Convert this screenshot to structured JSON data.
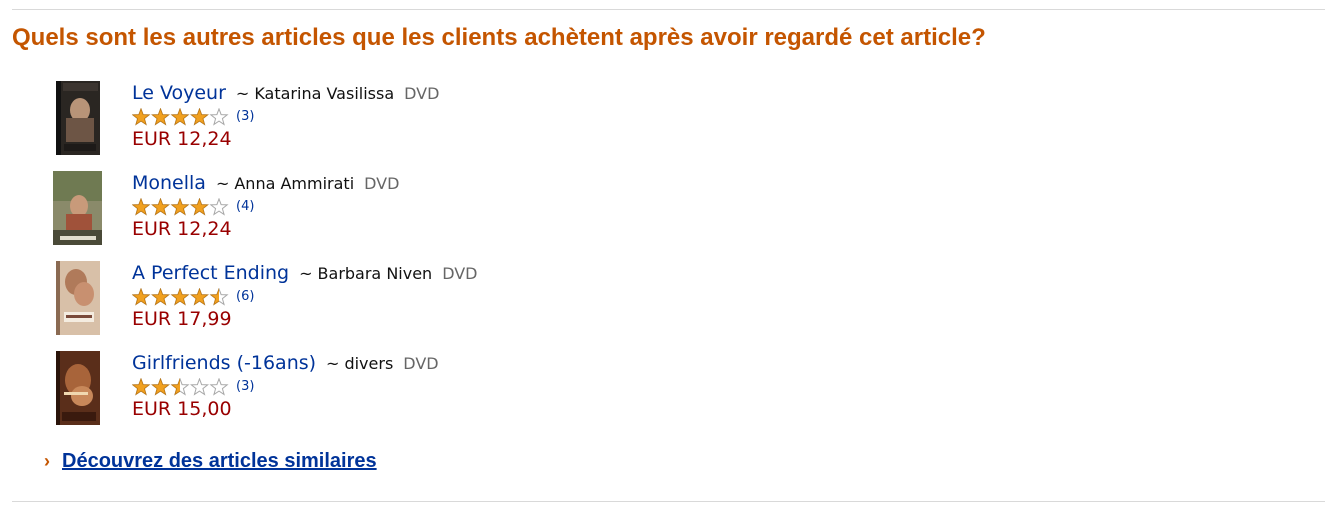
{
  "section": {
    "heading": "Quels sont les autres articles que les clients achètent après avoir regardé cet article?"
  },
  "items": [
    {
      "title": "Le Voyeur",
      "tilde": "~",
      "author": "Katarina Vasilissa",
      "format": "DVD",
      "rating": 4,
      "rating_count": "(3)",
      "price": "EUR 12,24"
    },
    {
      "title": "Monella",
      "tilde": "~",
      "author": "Anna Ammirati",
      "format": "DVD",
      "rating": 4,
      "rating_count": "(4)",
      "price": "EUR 12,24"
    },
    {
      "title": "A Perfect Ending",
      "tilde": "~",
      "author": "Barbara Niven",
      "format": "DVD",
      "rating": 4.5,
      "rating_count": "(6)",
      "price": "EUR 17,99"
    },
    {
      "title": "Girlfriends (-16ans)",
      "tilde": "~",
      "author": "divers",
      "format": "DVD",
      "rating": 2.5,
      "rating_count": "(3)",
      "price": "EUR 15,00"
    }
  ],
  "discover": {
    "chevron": "›",
    "link": "Découvrez des articles similaires"
  },
  "colors": {
    "heading": "#c45500",
    "link": "#003399",
    "price": "#990000",
    "star_fill": "#f0a020",
    "star_empty": "#ffffff",
    "star_outline": "#a8a8a8"
  }
}
